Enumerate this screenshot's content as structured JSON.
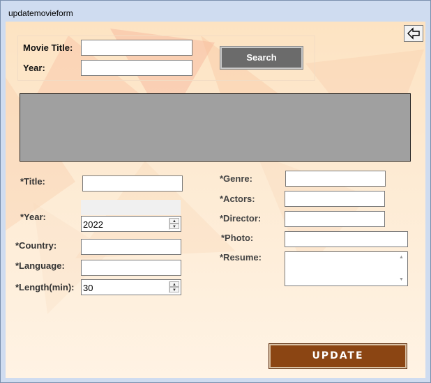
{
  "window": {
    "title": "updatemovieform"
  },
  "search": {
    "title_label": "Movie Title:",
    "year_label": "Year:",
    "title_value": "",
    "year_value": "",
    "button_label": "Search"
  },
  "form": {
    "title_label": "*Title:",
    "year_label": "*Year:",
    "country_label": "*Country:",
    "language_label": "*Language:",
    "length_label": "*Length(min):",
    "genre_label": "*Genre:",
    "actors_label": "*Actors:",
    "director_label": "*Director:",
    "photo_label": "*Photo:",
    "resume_label": "*Resume:",
    "year_value": "2022",
    "length_value": "30",
    "title_value": "",
    "country_value": "",
    "language_value": "",
    "genre_value": "",
    "actors_value": "",
    "director_value": "",
    "photo_value": "",
    "resume_value": ""
  },
  "update_button": {
    "label": "UPDATE"
  },
  "icons": {
    "back": "back-arrow-icon",
    "spin_up": "spin-up-icon",
    "spin_down": "spin-down-icon"
  }
}
